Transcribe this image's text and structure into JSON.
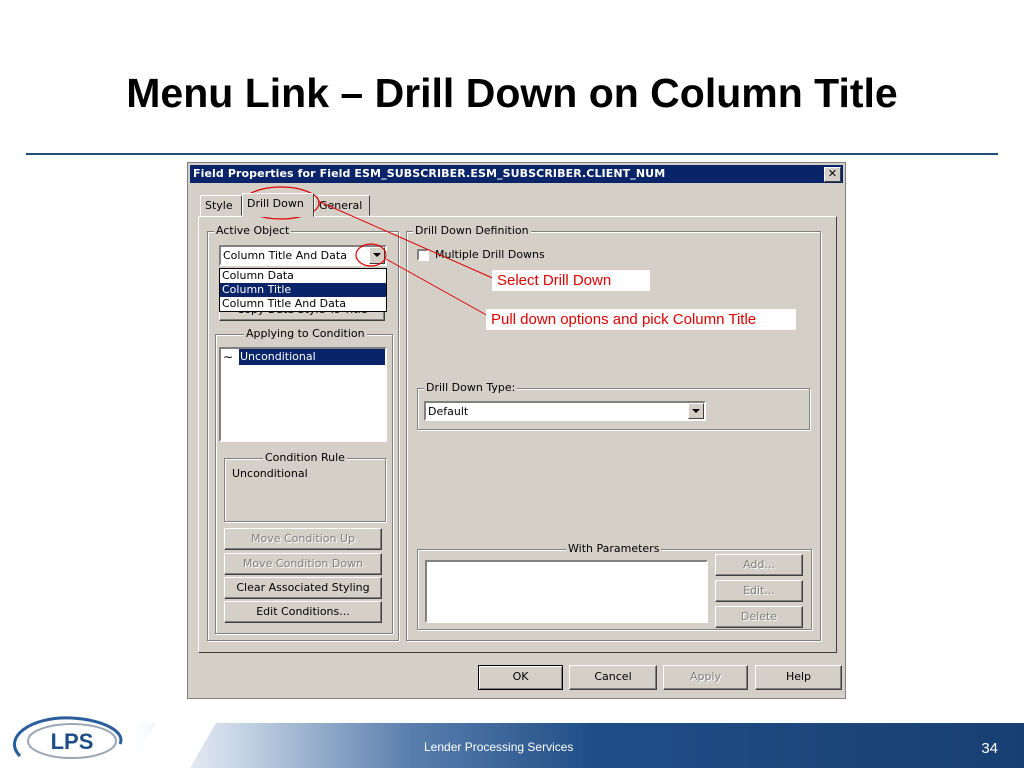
{
  "slide": {
    "title": "Menu Link – Drill Down on Column Title",
    "footer_text": "Lender Processing Services",
    "page_number": "34",
    "logo_text": "LPS"
  },
  "dialog": {
    "title": "Field Properties for Field ESM_SUBSCRIBER.ESM_SUBSCRIBER.CLIENT_NUM",
    "close_glyph": "✕",
    "tabs": [
      {
        "label": "Style",
        "active": false
      },
      {
        "label": "Drill Down",
        "active": true
      },
      {
        "label": "General",
        "active": false
      }
    ],
    "active_object": {
      "group_label": "Active Object",
      "selected": "Column Title And Data",
      "options": [
        "Column Data",
        "Column Title",
        "Column Title And Data"
      ],
      "highlighted_option": "Column Title",
      "hidden_button_text": "Copy Data Style To Title"
    },
    "applying_to_condition": {
      "group_label": "Applying to Condition",
      "items": [
        {
          "icon": "∼",
          "label": "Unconditional"
        }
      ]
    },
    "condition_rule": {
      "group_label": "Condition Rule",
      "text": "Unconditional"
    },
    "condition_buttons": {
      "move_up": "Move Condition Up",
      "move_down": "Move Condition Down",
      "clear_styling": "Clear Associated Styling",
      "edit_conditions": "Edit Conditions..."
    },
    "drill_down_definition": {
      "group_label": "Drill Down Definition",
      "multiple_checkbox_label": "Multiple Drill Downs",
      "multiple_checked": false,
      "type_group_label": "Drill Down Type:",
      "type_value": "Default",
      "with_parameters_label": "With Parameters",
      "param_buttons": {
        "add": "Add...",
        "edit": "Edit...",
        "delete": "Delete"
      }
    },
    "bottom_buttons": {
      "ok": "OK",
      "cancel": "Cancel",
      "apply": "Apply",
      "help": "Help"
    }
  },
  "annotations": {
    "callout_1": "Select Drill Down",
    "callout_2": "Pull down options and pick Column Title",
    "color": "#e00000"
  },
  "colors": {
    "titlebar": "#0a246a",
    "dialog_bg": "#d4d0c8",
    "footer_dark": "#183f73",
    "rule": "#1f4e79"
  }
}
